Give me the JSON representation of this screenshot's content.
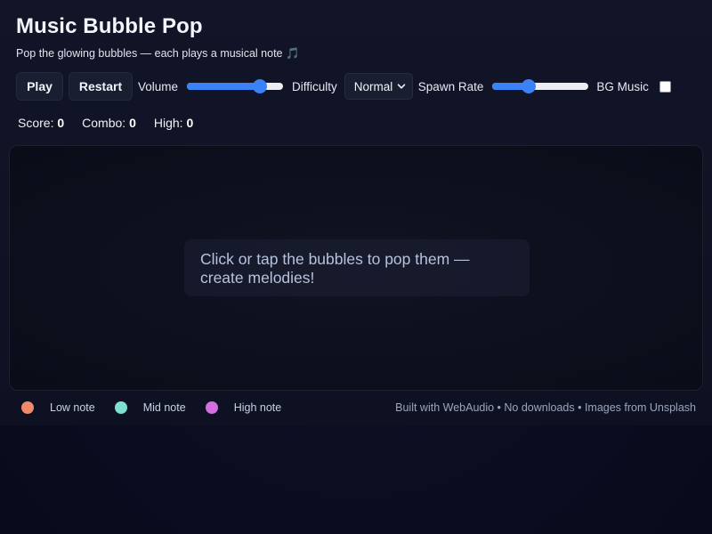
{
  "header": {
    "title": "Music Bubble Pop",
    "subtitle": "Pop the glowing bubbles — each plays a musical note 🎵"
  },
  "controls": {
    "play_label": "Play",
    "restart_label": "Restart",
    "volume_label": "Volume",
    "volume_value": 0.8,
    "difficulty_label": "Difficulty",
    "difficulty_selected": "Normal",
    "spawn_rate_label": "Spawn Rate",
    "spawn_rate_value": 0.35,
    "bg_music_label": "BG Music",
    "bg_music_checked": false
  },
  "stats": {
    "score_label": "Score:",
    "score_value": "0",
    "combo_label": "Combo:",
    "combo_value": "0",
    "high_label": "High:",
    "high_value": "0"
  },
  "stage": {
    "hint": "Click or tap the bubbles to pop them — create melodies!"
  },
  "legend": {
    "items": [
      {
        "label": "Low note",
        "color": "#f08a6a"
      },
      {
        "label": "Mid note",
        "color": "#7fe0cf"
      },
      {
        "label": "High note",
        "color": "#d46ee0"
      }
    ]
  },
  "footer": {
    "text": "Built with WebAudio • No downloads • Images from Unsplash"
  },
  "colors": {
    "accent": "#3b82f6",
    "background": "#0b0d21"
  }
}
